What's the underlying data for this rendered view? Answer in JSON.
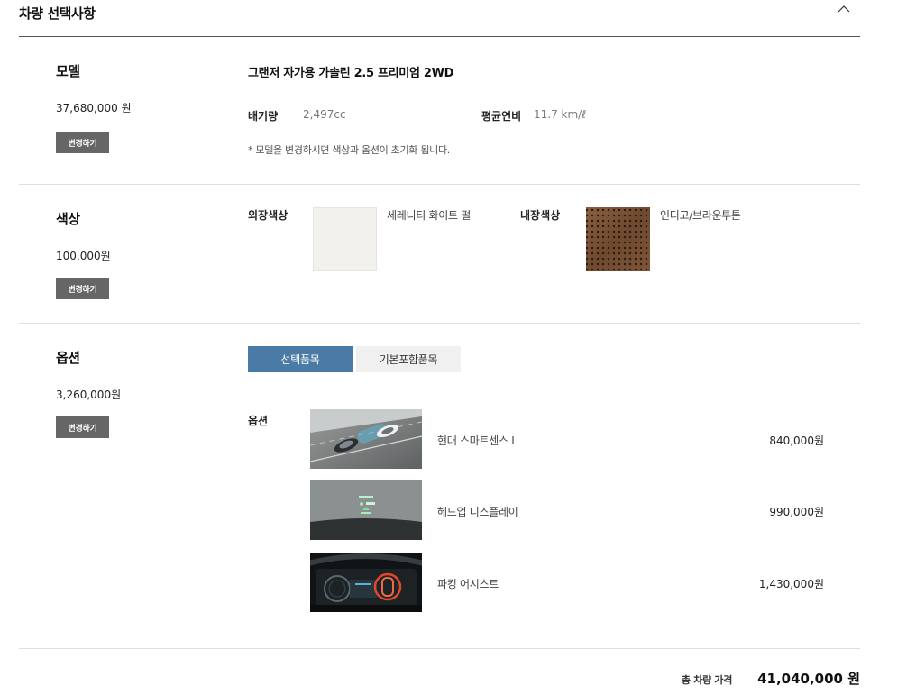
{
  "header": {
    "title": "차량 선택사항",
    "collapse_icon": "chevron-up-icon"
  },
  "model": {
    "label": "모델",
    "price": "37,680,000 원",
    "change_label": "변경하기",
    "name": "그랜저 자가용 가솔린 2.5 프리미엄 2WD",
    "displacement_label": "배기량",
    "displacement_value": "2,497cc",
    "fuel_label": "평균연비",
    "fuel_value": "11.7 km/ℓ",
    "note": "* 모델을 변경하시면 색상과 옵션이 초기화 됩니다."
  },
  "color": {
    "label": "색상",
    "price": "100,000원",
    "change_label": "변경하기",
    "exterior_label": "외장색상",
    "exterior_name": "세레니티 화이트 펄",
    "exterior_color": "#f2f1ec",
    "interior_label": "내장색상",
    "interior_name": "인디고/브라운투톤",
    "interior_color": "#7a5236"
  },
  "option": {
    "label": "옵션",
    "price": "3,260,000원",
    "change_label": "변경하기",
    "tabs": [
      {
        "label": "선택품목",
        "active": true
      },
      {
        "label": "기본포함품목",
        "active": false
      }
    ],
    "accent_color": "#4a7ba6",
    "list_heading": "옵션",
    "items": [
      {
        "name": "현대 스마트센스 Ⅰ",
        "price": "840,000원"
      },
      {
        "name": "헤드업 디스플레이",
        "price": "990,000원"
      },
      {
        "name": "파킹 어시스트",
        "price": "1,430,000원"
      }
    ]
  },
  "total": {
    "label": "총 차량 가격",
    "value": "41,040,000 원"
  }
}
